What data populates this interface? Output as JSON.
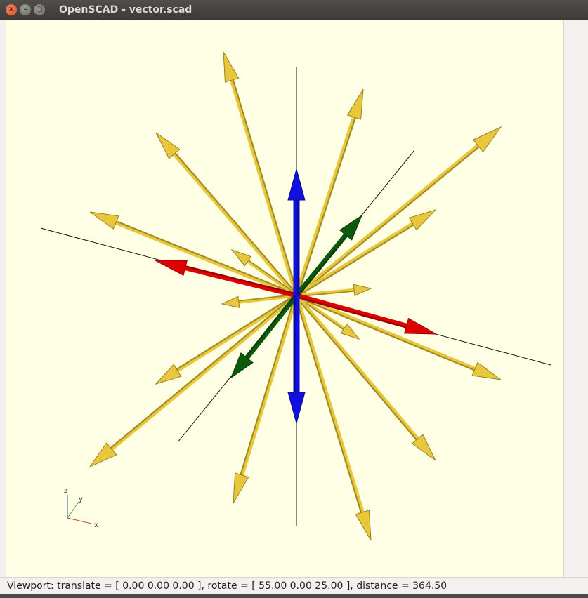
{
  "window": {
    "title": "OpenSCAD - vector.scad"
  },
  "viewport": {
    "axis_labels": {
      "x": "x",
      "y": "y",
      "z": "z"
    }
  },
  "statusbar": {
    "text": "Viewport: translate = [ 0.00 0.00 0.00 ], rotate = [ 55.00 0.00 25.00 ], distance = 364.50"
  },
  "colors": {
    "background": "#ffffe5",
    "arrow_yellow": "#e8c83a",
    "x_axis_red": "#e00000",
    "y_axis_green": "#0b5a0b",
    "z_axis_blue": "#1010e0"
  },
  "icons": {
    "close": "close-icon",
    "minimize": "minimize-icon",
    "maximize": "maximize-icon"
  }
}
